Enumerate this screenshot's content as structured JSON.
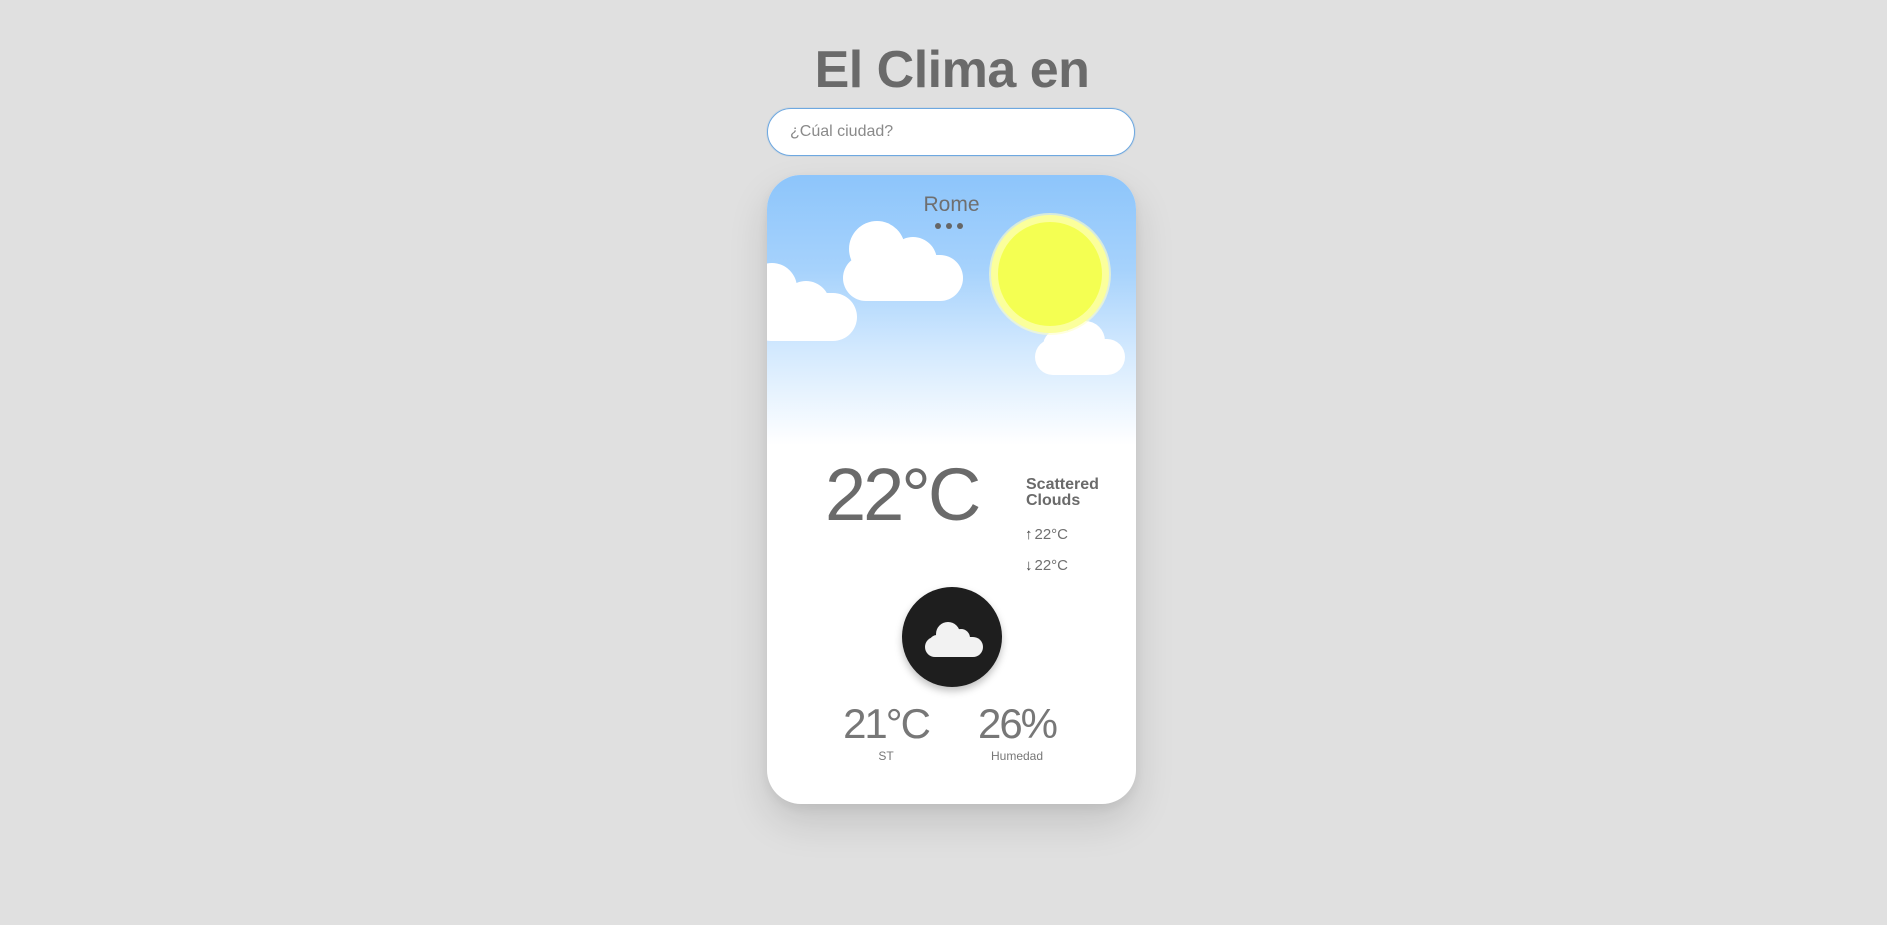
{
  "header": {
    "title": "El Clima en"
  },
  "search": {
    "placeholder": "¿Cúal ciudad?",
    "value": ""
  },
  "weather": {
    "city": "Rome",
    "temperature": "22°C",
    "description": "Scattered Clouds",
    "max_temp": "22°C",
    "min_temp": "22°C",
    "icon": "cloud-icon",
    "feels_like": "21°C",
    "feels_like_label": "ST",
    "humidity": "26%",
    "humidity_label": "Humedad"
  },
  "colors": {
    "background": "#e0e0e0",
    "sky_top": "#8dc5fb",
    "sun": "#f4ff52",
    "icon_bg": "#1e1e1e",
    "search_border": "#6ea8e0"
  }
}
